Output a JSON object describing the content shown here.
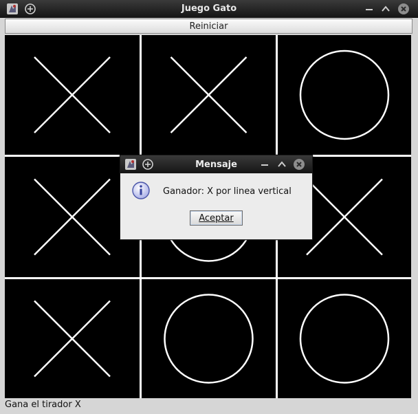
{
  "window": {
    "title": "Juego Gato"
  },
  "toolbar": {
    "reset_label": "Reiniciar"
  },
  "board": {
    "cells": [
      "X",
      "X",
      "O",
      "X",
      "O",
      "X",
      "X",
      "O",
      "O"
    ]
  },
  "status": {
    "text": "Gana el tirador X"
  },
  "dialog": {
    "title": "Mensaje",
    "message": "Ganador: X por linea vertical",
    "ok_label": "Aceptar"
  },
  "icons": {
    "app": "app-icon",
    "add": "plus-circle-icon",
    "minimize": "minimize-icon",
    "maximize": "maximize-icon",
    "close": "close-icon",
    "info": "info-icon"
  }
}
